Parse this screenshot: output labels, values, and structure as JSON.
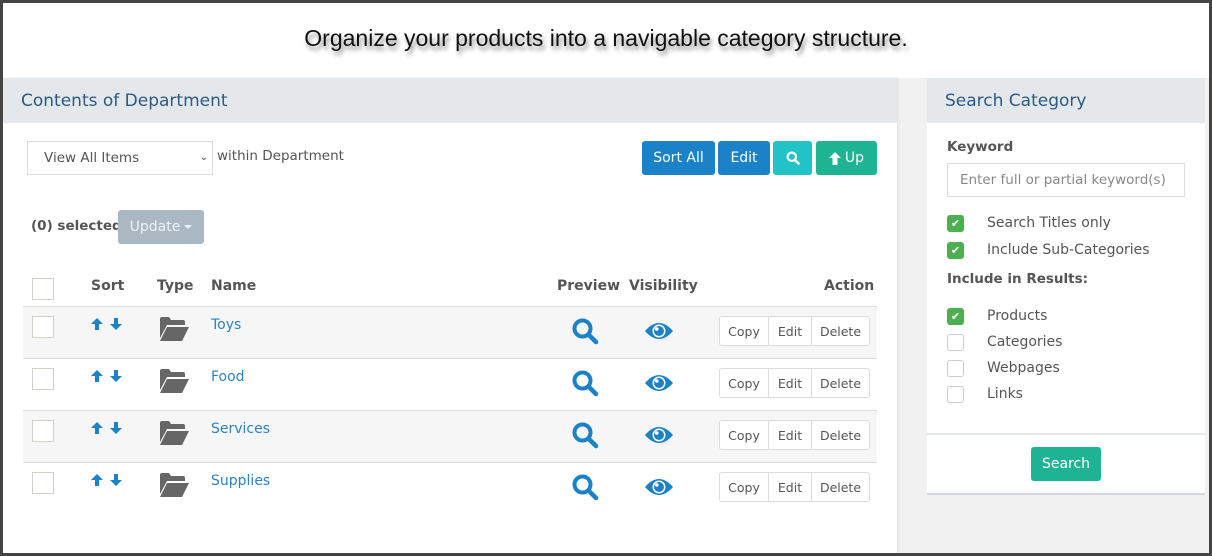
{
  "banner": {
    "text": "Organize your products into a navigable category structure."
  },
  "left_panel": {
    "title": "Contents of Department",
    "view_select": {
      "value": "View All Items"
    },
    "within_label": "within Department",
    "toolbar": {
      "sort_all": "Sort All",
      "edit": "Edit",
      "search_icon": "search-icon",
      "up": "Up"
    },
    "selected_label": "(0) selected",
    "update_button": "Update",
    "table": {
      "headers": {
        "sort": "Sort",
        "type": "Type",
        "name": "Name",
        "preview": "Preview",
        "visibility": "Visibility",
        "action": "Action"
      },
      "rows": [
        {
          "name": "Toys",
          "type": "folder",
          "visible": true
        },
        {
          "name": "Food",
          "type": "folder",
          "visible": true
        },
        {
          "name": "Services",
          "type": "folder",
          "visible": true
        },
        {
          "name": "Supplies",
          "type": "folder",
          "visible": true
        }
      ],
      "actions": {
        "copy": "Copy",
        "edit": "Edit",
        "delete": "Delete"
      }
    }
  },
  "right_panel": {
    "title": "Search Category",
    "keyword_label": "Keyword",
    "keyword_placeholder": "Enter full or partial keyword(s)",
    "keyword_value": "",
    "options": [
      {
        "label": "Search Titles only",
        "checked": true
      },
      {
        "label": "Include Sub-Categories",
        "checked": true
      }
    ],
    "include_label": "Include in Results:",
    "include_options": [
      {
        "label": "Products",
        "checked": true
      },
      {
        "label": "Categories",
        "checked": false
      },
      {
        "label": "Webpages",
        "checked": false
      },
      {
        "label": "Links",
        "checked": false
      }
    ],
    "search_button": "Search"
  },
  "colors": {
    "primary": "#1b82c8",
    "info": "#22c3c6",
    "success": "#1db393",
    "check": "#4caf50",
    "header_text": "#2a5a85"
  }
}
